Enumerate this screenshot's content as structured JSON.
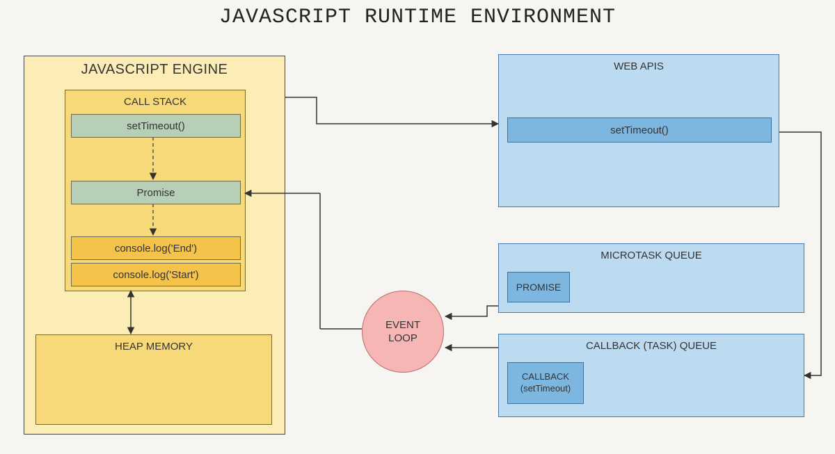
{
  "title": "JAVASCRIPT RUNTIME ENVIRONMENT",
  "engine": {
    "title": "JAVASCRIPT ENGINE",
    "call_stack": {
      "title": "CALL STACK",
      "items": [
        {
          "label": "setTimeout()",
          "tone": "green"
        },
        {
          "label": "Promise",
          "tone": "green"
        },
        {
          "label": "console.log('End')",
          "tone": "amber"
        },
        {
          "label": "console.log('Start')",
          "tone": "amber"
        }
      ]
    },
    "heap": {
      "title": "HEAP MEMORY"
    }
  },
  "event_loop": {
    "label": "EVENT\nLOOP"
  },
  "web_apis": {
    "title": "WEB APIS",
    "items": [
      {
        "label": "setTimeout()"
      }
    ]
  },
  "microtask_queue": {
    "title": "MICROTASK QUEUE",
    "items": [
      {
        "label": "PROMISE"
      }
    ]
  },
  "callback_queue": {
    "title": "CALLBACK (TASK) QUEUE",
    "items": [
      {
        "label": "CALLBACK\n(setTimeout)"
      }
    ]
  },
  "colors": {
    "engine_bg": "#fcedb6",
    "stack_bg": "#f7d97a",
    "stack_green": "#b7cfb6",
    "stack_amber": "#f5c24a",
    "blue_light": "#bcdaf0",
    "blue_inner": "#7db6df",
    "event_loop": "#f6b6b6"
  }
}
